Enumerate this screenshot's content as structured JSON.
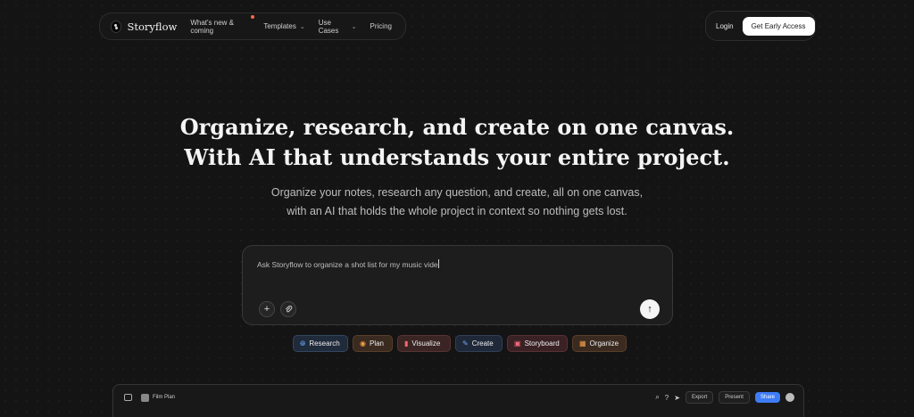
{
  "nav": {
    "brand": "Storyflow",
    "items": [
      {
        "label": "What's new & coming",
        "badge": true
      },
      {
        "label": "Templates",
        "chevron": true
      },
      {
        "label": "Use Cases",
        "chevron": true
      },
      {
        "label": "Pricing"
      }
    ],
    "login": "Login",
    "cta": "Get Early Access"
  },
  "hero": {
    "title_line1": "Organize, research, and create on one canvas.",
    "title_line2": "With AI that understands your entire project.",
    "sub_line1": "Organize your notes, research any question, and create, all on one canvas,",
    "sub_line2": "with an AI that holds the whole project in context so nothing gets lost."
  },
  "prompt": {
    "value": "Ask Storyflow to organize a shot list for my music vide"
  },
  "chips": [
    {
      "label": "Research",
      "icon": "globe-icon"
    },
    {
      "label": "Plan",
      "icon": "compass-icon"
    },
    {
      "label": "Visualize",
      "icon": "bar-chart-icon"
    },
    {
      "label": "Create",
      "icon": "wand-icon"
    },
    {
      "label": "Storyboard",
      "icon": "camera-icon"
    },
    {
      "label": "Organize",
      "icon": "grid-icon"
    }
  ],
  "preview": {
    "title": "Film Plan",
    "export": "Export",
    "present": "Present",
    "share": "Share"
  },
  "colors": {
    "background": "#141414",
    "share_blue": "#3d7cf5",
    "badge_orange": "#f56a4a"
  }
}
